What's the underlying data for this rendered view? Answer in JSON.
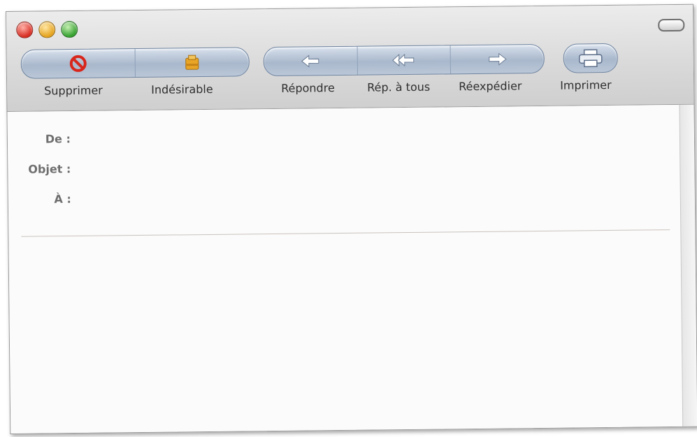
{
  "window": {
    "controls": [
      "close-icon",
      "minimize-icon",
      "zoom-icon"
    ],
    "toolbar_toggle_icon": "toolbar-toggle-icon"
  },
  "toolbar": {
    "delete_label": "Supprimer",
    "junk_label": "Indésirable",
    "reply_label": "Répondre",
    "reply_all_label": "Rép. à tous",
    "forward_label": "Réexpédier",
    "print_label": "Imprimer",
    "icons": {
      "delete": "no-entry-icon",
      "junk": "junk-bag-icon",
      "reply": "reply-arrow-icon",
      "reply_all": "reply-all-arrow-icon",
      "forward": "forward-arrow-icon",
      "print": "printer-icon"
    }
  },
  "headers": {
    "from_label": "De :",
    "subject_label": "Objet :",
    "to_label": "À :"
  },
  "colors": {
    "accent": "#a9b8cc",
    "close": "#d6281d",
    "minimize": "#e4a018",
    "zoom": "#2f9e2a",
    "delete_icon": "#d8261c",
    "junk_icon": "#e9a526"
  }
}
